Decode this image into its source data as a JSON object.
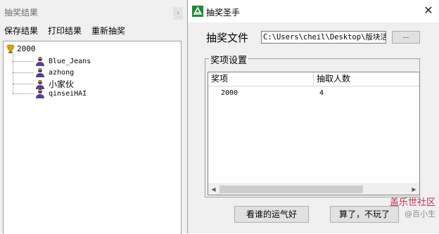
{
  "results_window": {
    "title": "抽奖结果",
    "menu": [
      "保存结果",
      "打印结果",
      "重新抽奖"
    ],
    "tree": {
      "root": "2000",
      "children": [
        "Blue_Jeans",
        "azhong",
        "小家伙",
        "qinseiHAI"
      ]
    }
  },
  "dialog": {
    "title": "抽奖圣手",
    "file_label": "抽奖文件",
    "file_path": "C:\\Users\\cheil\\Desktop\\版块活",
    "browse_label": "...",
    "group_label": "奖项设置",
    "columns": [
      "奖项",
      "抽取人数"
    ],
    "rows": [
      {
        "prize": "2000",
        "count": "4"
      }
    ],
    "buttons": {
      "start": "看谁的运气好",
      "quit": "算了，不玩了"
    }
  },
  "watermark": {
    "line1": "盖乐世社区",
    "line2": "@百小生"
  },
  "colors": {
    "window_bg": "#f0f0f0",
    "watermark": "#c02f4b",
    "icon_green": "#1f8a3a"
  },
  "icons": {
    "root": "trophy-icon",
    "child": "person-icon",
    "app": "app-logo-icon"
  }
}
